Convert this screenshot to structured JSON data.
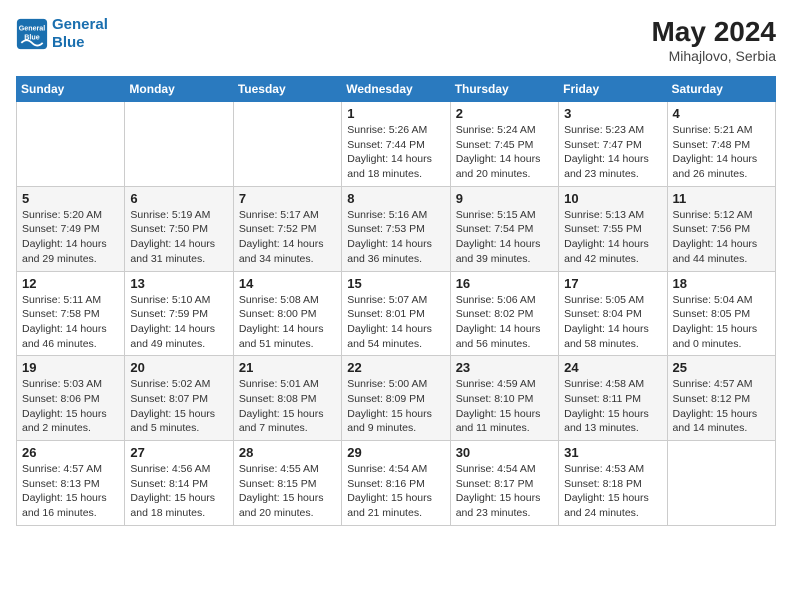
{
  "header": {
    "logo_line1": "General",
    "logo_line2": "Blue",
    "month_year": "May 2024",
    "location": "Mihajlovo, Serbia"
  },
  "weekdays": [
    "Sunday",
    "Monday",
    "Tuesday",
    "Wednesday",
    "Thursday",
    "Friday",
    "Saturday"
  ],
  "weeks": [
    [
      {
        "day": "",
        "info": ""
      },
      {
        "day": "",
        "info": ""
      },
      {
        "day": "",
        "info": ""
      },
      {
        "day": "1",
        "info": "Sunrise: 5:26 AM\nSunset: 7:44 PM\nDaylight: 14 hours and 18 minutes."
      },
      {
        "day": "2",
        "info": "Sunrise: 5:24 AM\nSunset: 7:45 PM\nDaylight: 14 hours and 20 minutes."
      },
      {
        "day": "3",
        "info": "Sunrise: 5:23 AM\nSunset: 7:47 PM\nDaylight: 14 hours and 23 minutes."
      },
      {
        "day": "4",
        "info": "Sunrise: 5:21 AM\nSunset: 7:48 PM\nDaylight: 14 hours and 26 minutes."
      }
    ],
    [
      {
        "day": "5",
        "info": "Sunrise: 5:20 AM\nSunset: 7:49 PM\nDaylight: 14 hours and 29 minutes."
      },
      {
        "day": "6",
        "info": "Sunrise: 5:19 AM\nSunset: 7:50 PM\nDaylight: 14 hours and 31 minutes."
      },
      {
        "day": "7",
        "info": "Sunrise: 5:17 AM\nSunset: 7:52 PM\nDaylight: 14 hours and 34 minutes."
      },
      {
        "day": "8",
        "info": "Sunrise: 5:16 AM\nSunset: 7:53 PM\nDaylight: 14 hours and 36 minutes."
      },
      {
        "day": "9",
        "info": "Sunrise: 5:15 AM\nSunset: 7:54 PM\nDaylight: 14 hours and 39 minutes."
      },
      {
        "day": "10",
        "info": "Sunrise: 5:13 AM\nSunset: 7:55 PM\nDaylight: 14 hours and 42 minutes."
      },
      {
        "day": "11",
        "info": "Sunrise: 5:12 AM\nSunset: 7:56 PM\nDaylight: 14 hours and 44 minutes."
      }
    ],
    [
      {
        "day": "12",
        "info": "Sunrise: 5:11 AM\nSunset: 7:58 PM\nDaylight: 14 hours and 46 minutes."
      },
      {
        "day": "13",
        "info": "Sunrise: 5:10 AM\nSunset: 7:59 PM\nDaylight: 14 hours and 49 minutes."
      },
      {
        "day": "14",
        "info": "Sunrise: 5:08 AM\nSunset: 8:00 PM\nDaylight: 14 hours and 51 minutes."
      },
      {
        "day": "15",
        "info": "Sunrise: 5:07 AM\nSunset: 8:01 PM\nDaylight: 14 hours and 54 minutes."
      },
      {
        "day": "16",
        "info": "Sunrise: 5:06 AM\nSunset: 8:02 PM\nDaylight: 14 hours and 56 minutes."
      },
      {
        "day": "17",
        "info": "Sunrise: 5:05 AM\nSunset: 8:04 PM\nDaylight: 14 hours and 58 minutes."
      },
      {
        "day": "18",
        "info": "Sunrise: 5:04 AM\nSunset: 8:05 PM\nDaylight: 15 hours and 0 minutes."
      }
    ],
    [
      {
        "day": "19",
        "info": "Sunrise: 5:03 AM\nSunset: 8:06 PM\nDaylight: 15 hours and 2 minutes."
      },
      {
        "day": "20",
        "info": "Sunrise: 5:02 AM\nSunset: 8:07 PM\nDaylight: 15 hours and 5 minutes."
      },
      {
        "day": "21",
        "info": "Sunrise: 5:01 AM\nSunset: 8:08 PM\nDaylight: 15 hours and 7 minutes."
      },
      {
        "day": "22",
        "info": "Sunrise: 5:00 AM\nSunset: 8:09 PM\nDaylight: 15 hours and 9 minutes."
      },
      {
        "day": "23",
        "info": "Sunrise: 4:59 AM\nSunset: 8:10 PM\nDaylight: 15 hours and 11 minutes."
      },
      {
        "day": "24",
        "info": "Sunrise: 4:58 AM\nSunset: 8:11 PM\nDaylight: 15 hours and 13 minutes."
      },
      {
        "day": "25",
        "info": "Sunrise: 4:57 AM\nSunset: 8:12 PM\nDaylight: 15 hours and 14 minutes."
      }
    ],
    [
      {
        "day": "26",
        "info": "Sunrise: 4:57 AM\nSunset: 8:13 PM\nDaylight: 15 hours and 16 minutes."
      },
      {
        "day": "27",
        "info": "Sunrise: 4:56 AM\nSunset: 8:14 PM\nDaylight: 15 hours and 18 minutes."
      },
      {
        "day": "28",
        "info": "Sunrise: 4:55 AM\nSunset: 8:15 PM\nDaylight: 15 hours and 20 minutes."
      },
      {
        "day": "29",
        "info": "Sunrise: 4:54 AM\nSunset: 8:16 PM\nDaylight: 15 hours and 21 minutes."
      },
      {
        "day": "30",
        "info": "Sunrise: 4:54 AM\nSunset: 8:17 PM\nDaylight: 15 hours and 23 minutes."
      },
      {
        "day": "31",
        "info": "Sunrise: 4:53 AM\nSunset: 8:18 PM\nDaylight: 15 hours and 24 minutes."
      },
      {
        "day": "",
        "info": ""
      }
    ]
  ]
}
